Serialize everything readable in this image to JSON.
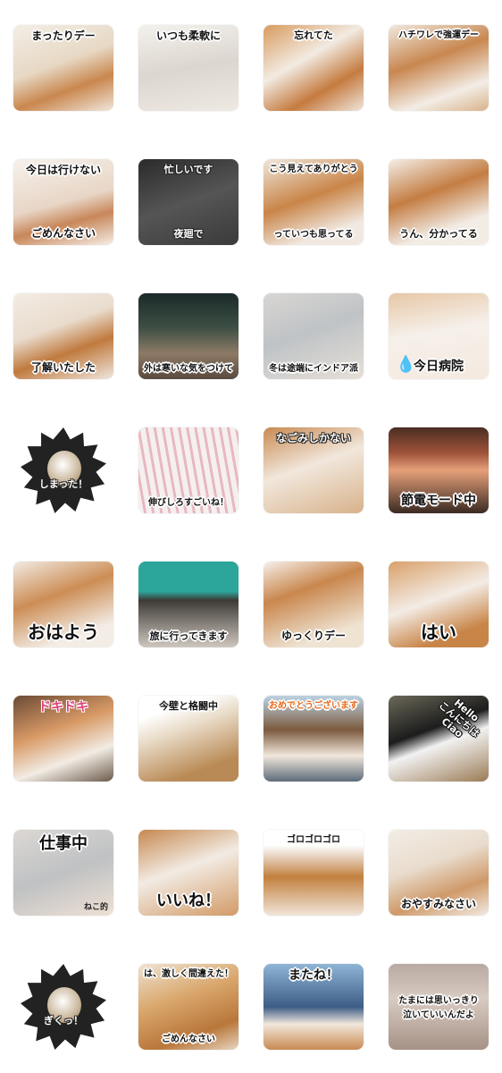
{
  "stickers": [
    {
      "id": "r1c1",
      "caption": "まったりデー",
      "pos": "top",
      "size": "s12",
      "bg": "linear-gradient(160deg,#f3eee6 0%,#e7d8c4 45%,#c9874e 70%,#f0e6da 100%)"
    },
    {
      "id": "r1c2",
      "caption": "いつも柔軟に",
      "pos": "top",
      "size": "s12",
      "bg": "linear-gradient(170deg,#f4f1ec 0%,#dcd6cf 50%,#efe9e3 100%)"
    },
    {
      "id": "r1c3",
      "caption": "忘れてた",
      "pos": "top",
      "size": "s11",
      "bg": "linear-gradient(150deg,#d89a5e 0%,#f2ebe2 40%,#c57b3f 70%,#efe6dc 100%)",
      "rot": "rot3"
    },
    {
      "id": "r1c4",
      "caption": "ハチワレで強運デー",
      "pos": "top",
      "size": "s10",
      "bg": "linear-gradient(160deg,#f1e9df 0%,#c88750 40%,#f3ede6 75%,#d8b28a 100%)"
    },
    {
      "id": "r2c1",
      "caption": "今日は行けない",
      "caption2": "ごめんなさい",
      "pos": "top",
      "size": "s12",
      "bg": "linear-gradient(165deg,#f6f1ec 0%,#e8d6c6 50%,#c8875a 70%,#f5eee6 100%)"
    },
    {
      "id": "r2c2",
      "caption": "忙しいです",
      "caption2": "夜廻で",
      "pos": "top",
      "size": "s11",
      "light": true,
      "bg": "linear-gradient(160deg,#2b2b2b 0%,#555 50%,#3a3a3a 100%)"
    },
    {
      "id": "r2c3",
      "caption": "こう見えてありがとう",
      "caption2": "っていつも思ってる",
      "pos": "top",
      "size": "s10",
      "bg": "linear-gradient(160deg,#efe7dd 0%,#c98548 45%,#f1e9e1 80%)"
    },
    {
      "id": "r2c4",
      "caption": "うん、分かってる",
      "pos": "bottom",
      "size": "s11",
      "bg": "linear-gradient(160deg,#f4efe8 0%,#c47d43 40%,#f2ece5 75%)"
    },
    {
      "id": "r3c1",
      "caption": "了解いたした",
      "pos": "bottom",
      "size": "s12",
      "bg": "linear-gradient(160deg,#f3ece4 0%,#e9dccd 40%,#c07a3e 65%,#efe7de 100%)"
    },
    {
      "id": "r3c2",
      "caption": "外は寒いな気をつけて",
      "pos": "bottom",
      "size": "s10",
      "bg": "linear-gradient(180deg,#1b2a2a 0%,#3d4f44 40%,#8d7a66 70%,#5a4a3e 100%)"
    },
    {
      "id": "r3c3",
      "caption": "冬は途端にインドア派",
      "pos": "bottom",
      "size": "s10",
      "bg": "linear-gradient(160deg,#d9d6d3 0%,#bfc3c6 45%,#e6dfd8 100%)"
    },
    {
      "id": "r3c4",
      "caption": "今日病院",
      "pos": "bottom",
      "size": "s14",
      "drop": "💧",
      "bg": "linear-gradient(170deg,#e6c7a6 0%,#f6f0ea 45%,#f4e9de 100%)"
    },
    {
      "id": "r4c1",
      "caption": "しまった！",
      "pos": "star",
      "size": "s11"
    },
    {
      "id": "r4c2",
      "caption": "伸びしろすごいね！",
      "pos": "bottom",
      "size": "s10",
      "bg": "repeating-linear-gradient(80deg,#f5f0ef 0px,#f5f0ef 6px,#e7b8c0 6px,#e7b8c0 9px)"
    },
    {
      "id": "r4c3",
      "caption": "なごみしかない",
      "pos": "top",
      "size": "s12",
      "light": true,
      "bg": "linear-gradient(160deg,#c98a52 0%,#f1e7dc 45%,#d8b28a 100%)"
    },
    {
      "id": "r4c4",
      "caption": "節電モード中",
      "pos": "bottom",
      "size": "s14",
      "bg": "linear-gradient(180deg,#4b2e22 0%,#a0533a 30%,#e6a07a 50%,#3a2a22 100%)"
    },
    {
      "id": "r5c1",
      "caption": "おはよう",
      "pos": "bottom",
      "size": "s20",
      "bg": "linear-gradient(160deg,#f2ebe3 0%,#cc8d55 40%,#f3ede6 80%)"
    },
    {
      "id": "r5c2",
      "caption": "旅に行ってきます",
      "pos": "bottom",
      "size": "s11",
      "bg": "linear-gradient(180deg,#2ca59b 0%,#2ca59b 35%,#3d3a35 45%,#cfc7bf 100%)"
    },
    {
      "id": "r5c3",
      "caption": "ゆっくりデー",
      "pos": "bottom",
      "size": "s12",
      "bg": "linear-gradient(160deg,#f6f0ea 0%,#c9874e 35%,#efe3d2 80%)"
    },
    {
      "id": "r5c4",
      "caption": "はい",
      "pos": "bottom",
      "size": "s20",
      "bg": "linear-gradient(160deg,#d9a06a 0%,#f3ece5 45%,#c98548 80%)"
    },
    {
      "id": "r6c1",
      "caption": "ドキドキ",
      "pos": "top",
      "size": "s14",
      "pink": true,
      "bg": "linear-gradient(160deg,#6b4a34 0%,#d89a66 40%,#f2ece4 70%,#6c5b4c 100%)"
    },
    {
      "id": "r6c2",
      "caption": "今壁と格闘中",
      "pos": "top",
      "size": "s11",
      "bg": "linear-gradient(160deg,#ffffff 0%,#ffffff 20%,#e9dcc9 40%,#b98a55 80%)"
    },
    {
      "id": "r6c3",
      "caption": "おめでとうございます",
      "pos": "top",
      "size": "s10",
      "orange": true,
      "bg": "linear-gradient(180deg,#bcd2e2 0%,#7c5a3e 40%,#f1e7dc 70%,#5d6b7a 100%)"
    },
    {
      "id": "r6c4",
      "caption": "Hello",
      "caption2": "こんにちは",
      "caption3": "Ciao",
      "pos": "hello",
      "size": "s11",
      "bg": "linear-gradient(160deg,#6c6a5a 0%,#1c1c1c 40%,#f2f2f2 55%,#9a7b55 100%)"
    },
    {
      "id": "r7c1",
      "caption": "仕事中",
      "caption2": "ねこ的",
      "pos": "top",
      "size": "s18",
      "bg": "linear-gradient(160deg,#dcd8d4 0%,#bfc1c3 50%,#efe1d5 100%)"
    },
    {
      "id": "r7c2",
      "caption": "いいね！",
      "pos": "bottom",
      "size": "s18",
      "bg": "linear-gradient(160deg,#c78850 0%,#f2ebe3 45%,#d29a66 100%)"
    },
    {
      "id": "r7c3",
      "caption": "ゴロゴロゴロ",
      "pos": "top",
      "size": "s10",
      "bg": "linear-gradient(180deg,#ffffff 0%,#ffffff 18%,#e9d6c5 30%,#c2803e 55%,#f1e6da 100%)"
    },
    {
      "id": "r7c4",
      "caption": "おやすみなさい",
      "pos": "bottom",
      "size": "s12",
      "bg": "linear-gradient(160deg,#f3ede6 0%,#e9dccd 40%,#cf9a6a 70%,#f2ebe3 100%)"
    },
    {
      "id": "r8c1",
      "caption": "ぎくっ！",
      "pos": "star",
      "size": "s11"
    },
    {
      "id": "r8c2",
      "caption": "は、激しく間違えた！",
      "caption2": "ごめんなさい",
      "pos": "top",
      "size": "s10",
      "bg": "linear-gradient(160deg,#efe3d2 0%,#d9a66b 40%,#b9773a 75%,#e8d6c1 100%)"
    },
    {
      "id": "r8c3",
      "caption": "またね！",
      "pos": "top",
      "size": "s14",
      "bg": "linear-gradient(180deg,#8fb5d6 0%,#3d5d86 50%,#f1e7dc 70%,#c98a52 100%)"
    },
    {
      "id": "r8c4",
      "caption": "たまには思いっきり",
      "caption2": "泣いていいんだよ",
      "pos": "mid",
      "size": "s10",
      "bg": "linear-gradient(180deg,#b8a9a2 0%,#d8cbc1 40%,#a69286 100%)"
    }
  ]
}
